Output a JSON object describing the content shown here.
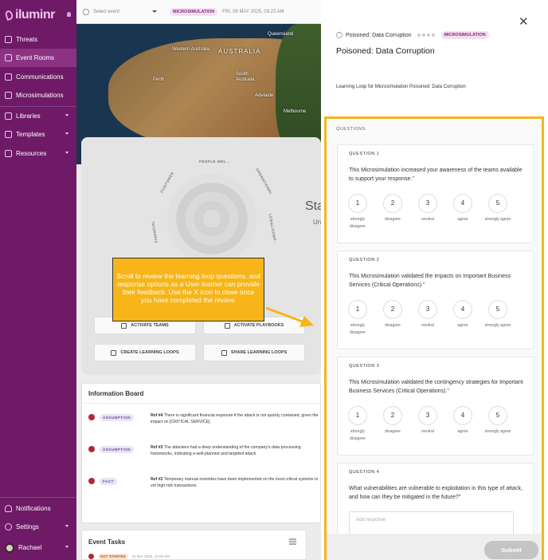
{
  "brand": {
    "name": "iluminr"
  },
  "nav": {
    "items": [
      {
        "label": "Threats",
        "icon": "threats-icon"
      },
      {
        "label": "Event Rooms",
        "icon": "event-rooms-icon"
      },
      {
        "label": "Communications",
        "icon": "communications-icon"
      },
      {
        "label": "Microsimulations",
        "icon": "microsimulations-icon"
      },
      {
        "label": "Libraries",
        "icon": "libraries-icon"
      },
      {
        "label": "Templates",
        "icon": "templates-icon"
      },
      {
        "label": "Resources",
        "icon": "resources-icon"
      }
    ],
    "bottom": [
      {
        "label": "Notifications"
      },
      {
        "label": "Settings"
      },
      {
        "label": "Rachael"
      }
    ]
  },
  "topbar": {
    "select_placeholder": "Select event",
    "badge": "MICROSIMULATION",
    "datetime": "FRI, 09 MAY 2025, 09:23 AM"
  },
  "map": {
    "country": "AUSTRALIA",
    "regions": [
      "Western Australia",
      "South Australia",
      "Queensland"
    ],
    "cities": [
      "Perth",
      "Adelaide",
      "Melbourne"
    ]
  },
  "radar": {
    "labels": [
      "PEOPLE WEL...",
      "OPERATIONAL",
      "CUSTOMER",
      "LEGAL/COMP...",
      "FINANCIAL"
    ]
  },
  "center": {
    "big": "Sta",
    "small": "Un"
  },
  "actions": {
    "activate_teams": "ACTIVATE TEAMS",
    "activate_playbooks": "ACTIVATE PLAYBOOKS",
    "create_learning_loops": "CREATE LEARNING LOOPS",
    "share_learning_loops": "SHARE LEARNING LOOPS"
  },
  "callout": {
    "text": "Scroll to review the learning loop questions, and response options as a User learner can provide their feedback. Use the X icon to close once you have completed the review."
  },
  "infoboard": {
    "title": "Information Board",
    "items": [
      {
        "tag": "ASSUMPTION",
        "ref": "Ref #4",
        "text": "There is significant financial exposure if the attack is not quickly contained, given the impact on [CRITICAL SERVICE]."
      },
      {
        "tag": "ASSUMPTION",
        "ref": "Ref #3",
        "text": "The attackers had a deep understanding of the company's data processing frameworks, indicating a well-planned and targeted attack"
      },
      {
        "tag": "FACT",
        "ref": "Ref #2",
        "text": "Temporary manual overrides have been implemented on the most critical systems to vet high-risk transactions."
      }
    ]
  },
  "eventtasks": {
    "title": "Event Tasks",
    "row_tag": "NOT STARTED",
    "row_date": "31 Dec 2025, 12:00 AM"
  },
  "panel": {
    "scenario": "Poisoned: Data Corruption",
    "badge": "MICROSIMULATION",
    "title": "Poisoned: Data Corruption",
    "subtitle": "Learning Loop for Microsimulation Poisoned: Data Corruption",
    "questions_label": "QUESTIONS",
    "questions": [
      {
        "num": "QUESTION 1",
        "text": "This Microsimulation increased your awareness of the teams available to support your response.\""
      },
      {
        "num": "QUESTION 2",
        "text": "This Microsimulation validated the impacts on Important Business Services (Critical Operations).\""
      },
      {
        "num": "QUESTION 3",
        "text": "This Microsimulation validated the contingency strategies for Important Business Services (Critical Operations).\""
      },
      {
        "num": "QUESTION 4",
        "text": "What vulnerabilities are vulnerable to exploitation in this type of attack, and how can they be mitigated in the future?\""
      }
    ],
    "options": [
      {
        "value": "1",
        "label": "strongly disagree"
      },
      {
        "value": "2",
        "label": "disagree"
      },
      {
        "value": "3",
        "label": "neutral"
      },
      {
        "value": "4",
        "label": "agree"
      },
      {
        "value": "5",
        "label": "strongly agree"
      }
    ],
    "response_placeholder": "Add response",
    "submit": "Submit"
  },
  "colors": {
    "sidebar": "#6e1a66",
    "accent": "#f7b51a",
    "badge_bg": "#f3dff0",
    "badge_text": "#8b2a80"
  }
}
